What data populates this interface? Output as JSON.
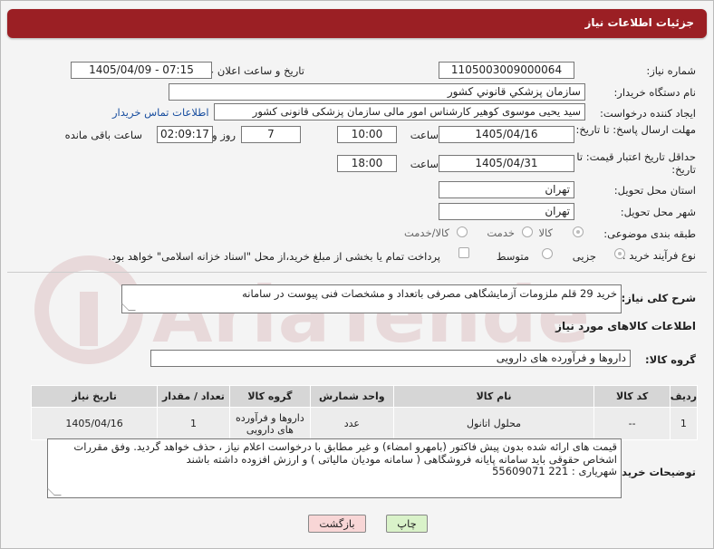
{
  "header": {
    "title": "جزئیات اطلاعات نیاز"
  },
  "fields": {
    "need_number_label": "شماره نیاز:",
    "need_number": "1105003009000064",
    "announce_label": "تاریخ و ساعت اعلان عمومی:",
    "announce_value": "1405/04/09 - 07:15",
    "buyer_org_label": "نام دستگاه خریدار:",
    "buyer_org": "سازمان پزشكي قانوني كشور",
    "requester_label": "ایجاد کننده درخواست:",
    "requester": "سید یحیی موسوی کوهیر کارشناس امور مالی سازمان پزشکی قانونی کشور",
    "contact_link": "اطلاعات تماس خریدار",
    "deadline_label": "مهلت ارسال پاسخ: تا تاریخ:",
    "deadline_date": "1405/04/16",
    "time_label": "ساعت",
    "deadline_time": "10:00",
    "days_value": "7",
    "days_label": "روز و",
    "remaining_time": "02:09:17",
    "remaining_label": "ساعت باقی مانده",
    "validity_label": "حداقل تاریخ اعتبار قیمت: تا تاریخ:",
    "validity_date": "1405/04/31",
    "validity_time_label": "ساعت",
    "validity_time": "18:00",
    "province_label": "استان محل تحویل:",
    "province": "تهران",
    "city_label": "شهر محل تحویل:",
    "city": "تهران",
    "category_label": "طبقه بندی موضوعی:",
    "category_options": [
      "کالا",
      "خدمت",
      "کالا/خدمت"
    ],
    "process_label": "نوع فرآیند خرید :",
    "process_options": [
      "جزیی",
      "متوسط"
    ],
    "payment_note": "پرداخت تمام یا بخشی از مبلغ خرید،از محل \"اسناد خزانه اسلامی\" خواهد بود."
  },
  "summary": {
    "label": "شرح کلی نیاز:",
    "text": "خرید 29 قلم ملزومات آزمایشگاهی مصرفی باتعداد و مشخصات فنی پیوست در سامانه"
  },
  "goods": {
    "section_title": "اطلاعات کالاهای مورد نیاز",
    "group_label": "گروه کالا:",
    "group_value": "داروها و فرآورده های دارویی",
    "columns": [
      "ردیف",
      "کد کالا",
      "نام کالا",
      "واحد شمارش",
      "گروه کالا",
      "تعداد / مقدار",
      "تاریخ نیاز"
    ],
    "rows": [
      [
        "1",
        "--",
        "محلول اتانول",
        "عدد",
        "داروها و فرآورده های دارویی",
        "1",
        "1405/04/16"
      ]
    ]
  },
  "buyer_notes": {
    "label": "توضیحات خریدار:",
    "line1": "قیمت های ارائه شده بدون پیش فاکتور (بامهرو امضاء) و غیر مطابق با درخواست اعلام نیاز  ، حذف خواهد گردید. وفق مقررات",
    "line2": "اشخاص حقوقی باید سامانه پایانه فروشگاهی ( سامانه مودیان مالیاتی ) و ارزش افزوده  داشته باشند",
    "line3": "شهریاری :     221     55609071"
  },
  "buttons": {
    "print": "چاپ",
    "back": "بازگشت"
  },
  "colors": {
    "header_bg": "#9b1f24",
    "print_bg": "#d9f2c9",
    "back_bg": "#f8d6d6",
    "link": "#1a4fa0"
  }
}
